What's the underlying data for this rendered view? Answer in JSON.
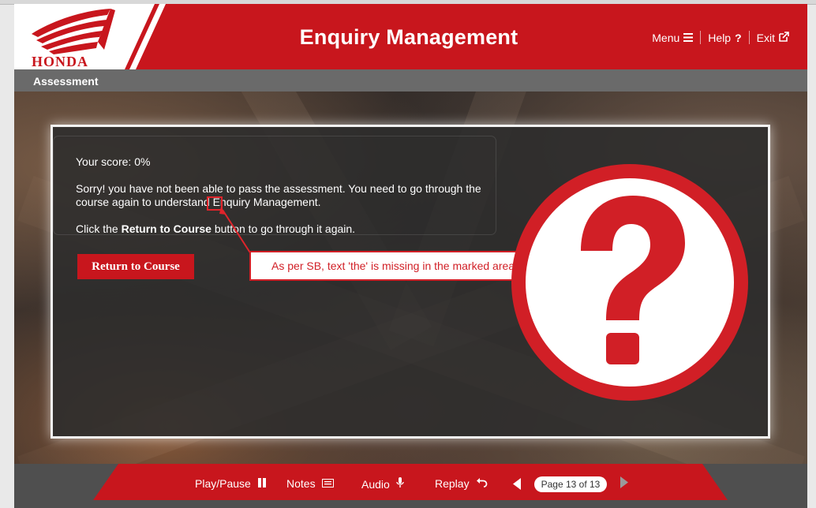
{
  "header": {
    "brand": "HONDA",
    "title": "Enquiry Management",
    "nav": [
      {
        "label": "Menu",
        "icon": "hamburger-icon"
      },
      {
        "label": "Help",
        "icon": "question-icon"
      },
      {
        "label": "Exit",
        "icon": "external-link-icon"
      }
    ]
  },
  "section": {
    "title": "Assessment"
  },
  "result": {
    "score_label": "Your score:",
    "score_value": "0%",
    "sorry_text": "Sorry! you have not been able to pass the assessment. You need to go through the course again to understand Enquiry Management.",
    "click_prefix": "Click the",
    "click_bold": "Return to Course",
    "click_suffix": "button to go through it again.",
    "button_label": "Return to Course"
  },
  "review_comment": "As per SB, text 'the' is missing in the marked area.",
  "footer": {
    "play_pause": "Play/Pause",
    "notes": "Notes",
    "audio": "Audio",
    "replay": "Replay",
    "page_indicator": "Page 13 of 13"
  },
  "colors": {
    "accent": "#c8161d",
    "panel": "#2c2c2c",
    "footer": "#c8161d"
  }
}
